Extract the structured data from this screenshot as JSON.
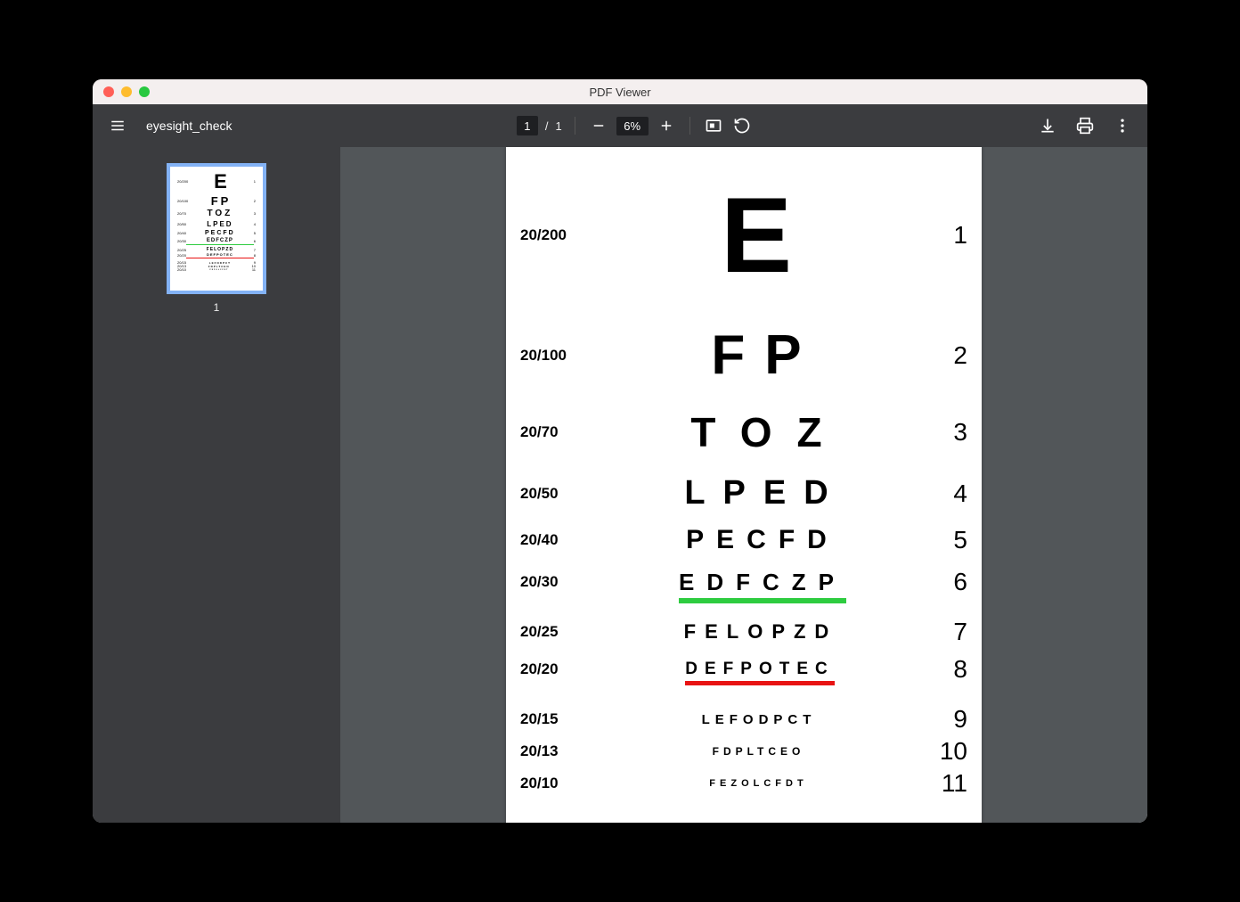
{
  "window": {
    "title": "PDF Viewer"
  },
  "toolbar": {
    "doc_name": "eyesight_check",
    "page_current": "1",
    "page_sep": "/",
    "page_total": "1",
    "zoom": "6%"
  },
  "thumbnails": {
    "items": [
      {
        "number": "1"
      }
    ]
  },
  "eye_chart": {
    "rows": [
      {
        "acuity": "20/200",
        "letters": "E",
        "num": "1"
      },
      {
        "acuity": "20/100",
        "letters": "FP",
        "num": "2"
      },
      {
        "acuity": "20/70",
        "letters": "TOZ",
        "num": "3"
      },
      {
        "acuity": "20/50",
        "letters": "LPED",
        "num": "4"
      },
      {
        "acuity": "20/40",
        "letters": "PECFD",
        "num": "5"
      },
      {
        "acuity": "20/30",
        "letters": "EDFCZP",
        "num": "6",
        "underline": "green"
      },
      {
        "acuity": "20/25",
        "letters": "FELOPZD",
        "num": "7"
      },
      {
        "acuity": "20/20",
        "letters": "DEFPOTEC",
        "num": "8",
        "underline": "red"
      },
      {
        "acuity": "20/15",
        "letters": "LEFODPCT",
        "num": "9"
      },
      {
        "acuity": "20/13",
        "letters": "FDPLTCEO",
        "num": "10"
      },
      {
        "acuity": "20/10",
        "letters": "FEZOLCFDT",
        "num": "11"
      }
    ]
  }
}
